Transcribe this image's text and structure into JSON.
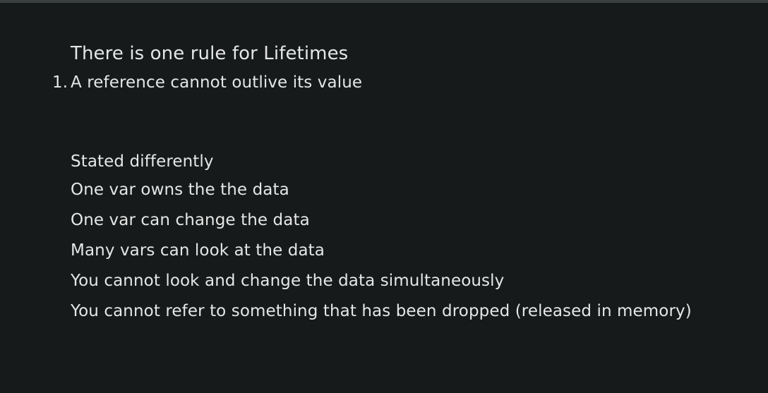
{
  "heading": "There is one rule for Lifetimes",
  "rules": [
    {
      "number": "1.",
      "text": "A reference cannot outlive its value"
    }
  ],
  "section_title": "Stated differently",
  "statements": [
    "One var owns the the data",
    "One var can change the data",
    "Many vars can look at the data",
    "You cannot look and change the data simultaneously",
    "You cannot refer to something that has been dropped (released in memory)"
  ],
  "colors": {
    "background": "#161a1a",
    "text": "#e6e6e6",
    "top_border": "#3a3f40"
  }
}
